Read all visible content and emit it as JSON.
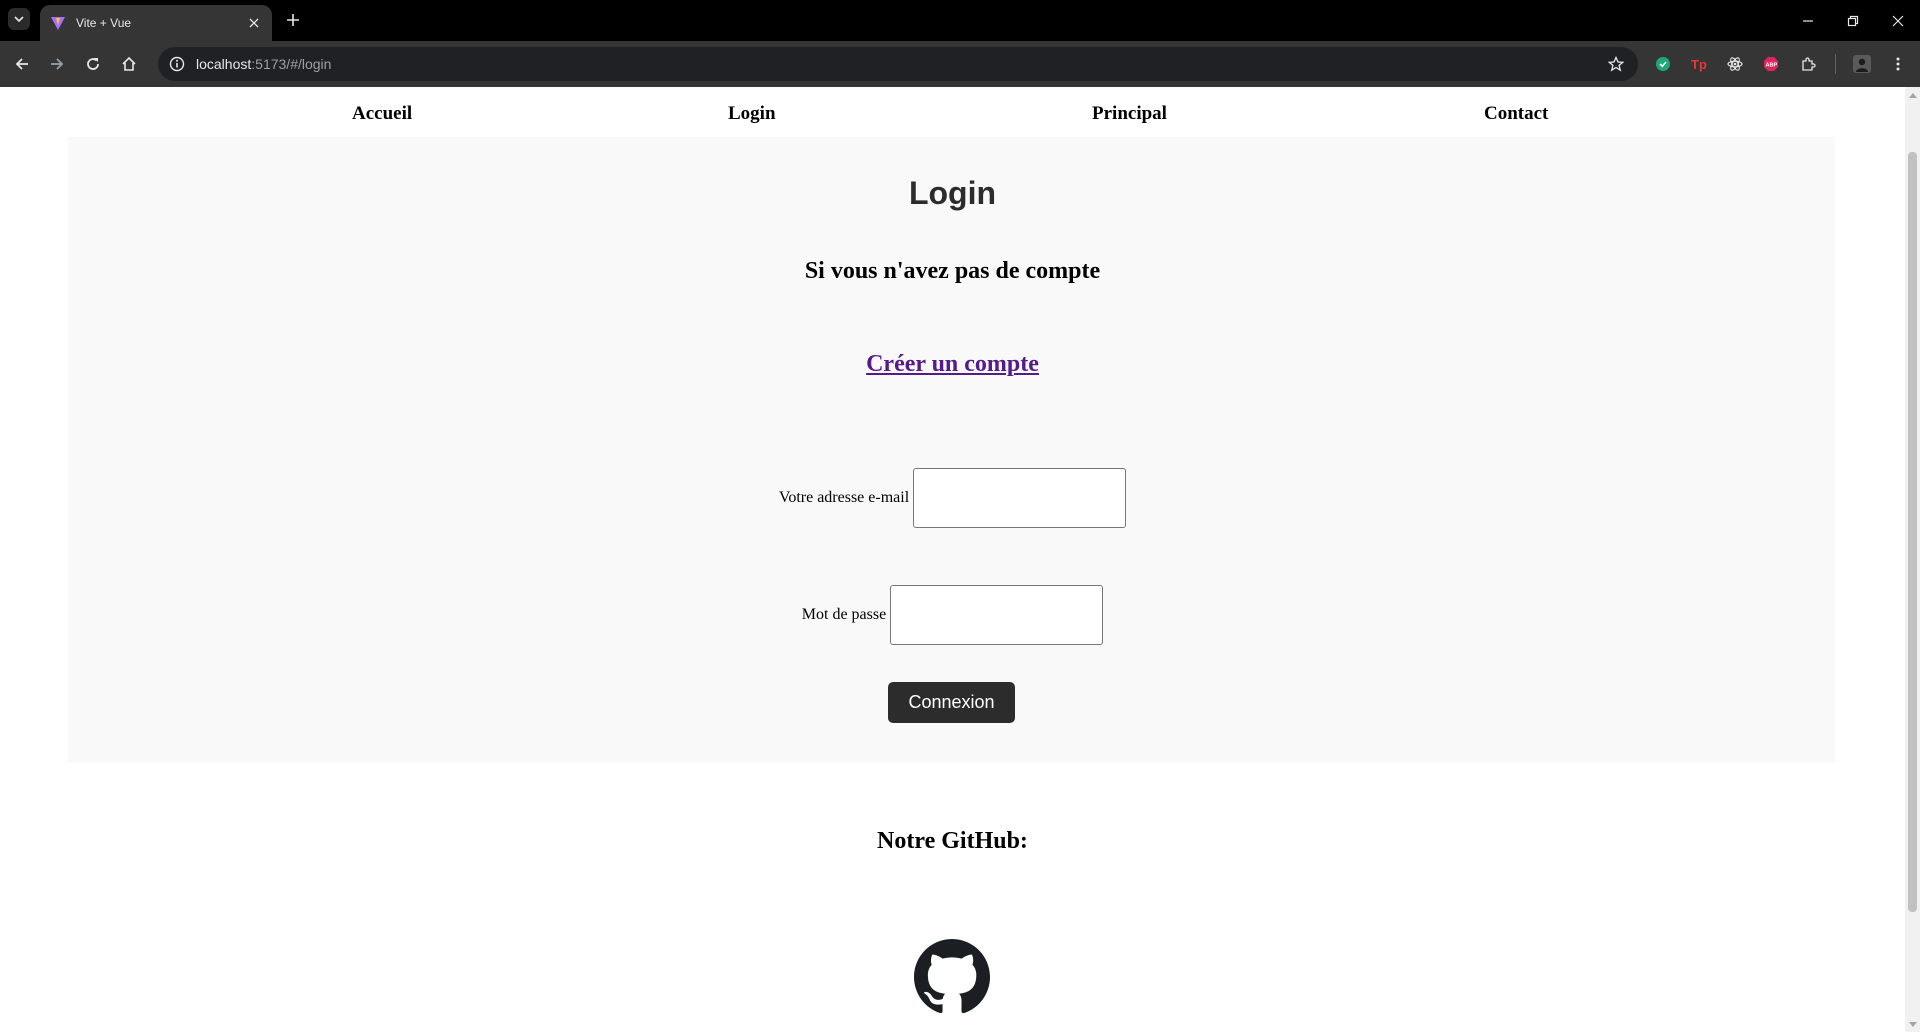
{
  "browser": {
    "tab_title": "Vite + Vue",
    "url_host": "localhost",
    "url_rest": ":5173/#/login"
  },
  "nav": {
    "items": [
      {
        "label": "Accueil"
      },
      {
        "label": "Login"
      },
      {
        "label": "Principal"
      },
      {
        "label": "Contact"
      }
    ]
  },
  "login": {
    "title": "Login",
    "subtitle": "Si vous n'avez pas de compte",
    "create_account_link": "Créer un compte",
    "email_label": "Votre adresse e-mail",
    "email_value": "",
    "password_label": "Mot de passe",
    "password_value": "",
    "submit_label": "Connexion"
  },
  "footer": {
    "github_heading": "Notre GitHub:",
    "github_icon": "github-icon"
  },
  "colors": {
    "card_bg": "#f9f9f9",
    "button_bg": "#2c2c2c",
    "link_visited": "#551a8b"
  }
}
